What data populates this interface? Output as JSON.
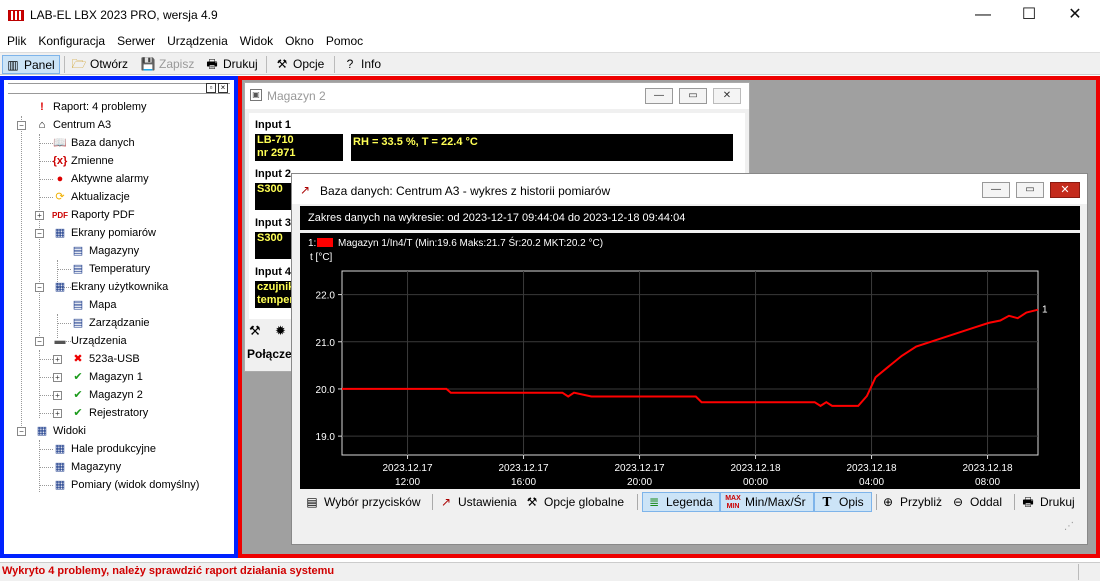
{
  "window": {
    "title": "LAB-EL LBX 2023 PRO, wersja 4.9",
    "minimize": "—",
    "maximize": "☐",
    "close": "✕"
  },
  "menu": [
    "Plik",
    "Konfiguracja",
    "Serwer",
    "Urządzenia",
    "Widok",
    "Okno",
    "Pomoc"
  ],
  "toolbar": {
    "panel": "Panel",
    "open": "Otwórz",
    "save": "Zapisz",
    "print": "Drukuj",
    "options": "Opcje",
    "info": "Info"
  },
  "tree": {
    "report": "Raport: 4 problemy",
    "centrum": "Centrum A3",
    "database": "Baza danych",
    "variables": "Zmienne",
    "alarms": "Aktywne alarmy",
    "updates": "Aktualizacje",
    "pdf_reports": "Raporty PDF",
    "measure_screens": "Ekrany pomiarów",
    "magazyny": "Magazyny",
    "temperatury": "Temperatury",
    "user_screens": "Ekrany użytkownika",
    "mapa": "Mapa",
    "zarzadzanie": "Zarządzanie",
    "devices": "Urządzenia",
    "dev_usb": "523a-USB",
    "dev_mag1": "Magazyn 1",
    "dev_mag2": "Magazyn 2",
    "dev_rej": "Rejestratory",
    "views": "Widoki",
    "view_hale": "Hale produkcyjne",
    "view_magazyny": "Magazyny",
    "view_pomiary": "Pomiary (widok domyślny)"
  },
  "mag2": {
    "title": "Magazyn 2",
    "input1": "Input 1",
    "input2": "Input 2",
    "input3": "Input 3",
    "input4": "Input 4",
    "dev1_line1": "LB-710",
    "dev1_line2": "nr 2971",
    "reading1": "RH = 33.5 %, T = 22.4 °C",
    "dev2": "S300",
    "dev3": "S300",
    "dev4_line1": "czujnik",
    "dev4_line2": "temper",
    "connection": "Połącze"
  },
  "chart_window": {
    "title": "Baza danych: Centrum A3 - wykres z historii pomiarów",
    "range": "Zakres danych na wykresie: od 2023-12-17 09:44:04 do 2023-12-18 09:44:04",
    "buttons": {
      "wybor": "Wybór przycisków",
      "ustawienia": "Ustawienia",
      "opcje_globalne": "Opcje globalne",
      "legenda": "Legenda",
      "minmax": "Min/Max/Śr",
      "opis": "Opis",
      "przybliz": "Przybliż",
      "oddal": "Oddal",
      "drukuj": "Drukuj"
    }
  },
  "chart_data": {
    "type": "line",
    "legend_prefix": "1:",
    "legend_text": "Magazyn 1/In4/T (Min:19.6 Maks:21.7 Śr:20.2 MKT:20.2 °C)",
    "ylabel": "t [°C]",
    "ylim": [
      18.6,
      22.5
    ],
    "yticks": [
      19.0,
      20.0,
      21.0,
      22.0
    ],
    "xlim": [
      0,
      24
    ],
    "xticks": [
      {
        "hour": 2.26,
        "date": "2023.12.17",
        "time": "12:00"
      },
      {
        "hour": 6.26,
        "date": "2023.12.17",
        "time": "16:00"
      },
      {
        "hour": 10.26,
        "date": "2023.12.17",
        "time": "20:00"
      },
      {
        "hour": 14.26,
        "date": "2023.12.18",
        "time": "00:00"
      },
      {
        "hour": 18.26,
        "date": "2023.12.18",
        "time": "04:00"
      },
      {
        "hour": 22.26,
        "date": "2023.12.18",
        "time": "08:00"
      }
    ],
    "series": [
      {
        "name": "Magazyn 1/In4/T",
        "label": "1",
        "color": "#ff0000",
        "points": [
          [
            0,
            20.0
          ],
          [
            3.6,
            20.0
          ],
          [
            3.75,
            19.92
          ],
          [
            7.6,
            19.92
          ],
          [
            7.8,
            19.84
          ],
          [
            8.0,
            19.92
          ],
          [
            8.6,
            19.84
          ],
          [
            12.2,
            19.84
          ],
          [
            12.4,
            19.72
          ],
          [
            16.3,
            19.72
          ],
          [
            16.5,
            19.64
          ],
          [
            16.7,
            19.72
          ],
          [
            16.9,
            19.64
          ],
          [
            17.8,
            19.64
          ],
          [
            18.1,
            19.85
          ],
          [
            18.4,
            20.25
          ],
          [
            18.8,
            20.45
          ],
          [
            19.3,
            20.7
          ],
          [
            19.8,
            20.9
          ],
          [
            20.3,
            21.0
          ],
          [
            20.8,
            21.1
          ],
          [
            21.3,
            21.2
          ],
          [
            21.8,
            21.3
          ],
          [
            22.3,
            21.4
          ],
          [
            22.7,
            21.45
          ],
          [
            23.0,
            21.55
          ],
          [
            23.3,
            21.5
          ],
          [
            23.6,
            21.62
          ],
          [
            24.0,
            21.68
          ]
        ]
      }
    ]
  },
  "status": {
    "message": "Wykryto 4 problemy, należy sprawdzić raport działania systemu"
  }
}
